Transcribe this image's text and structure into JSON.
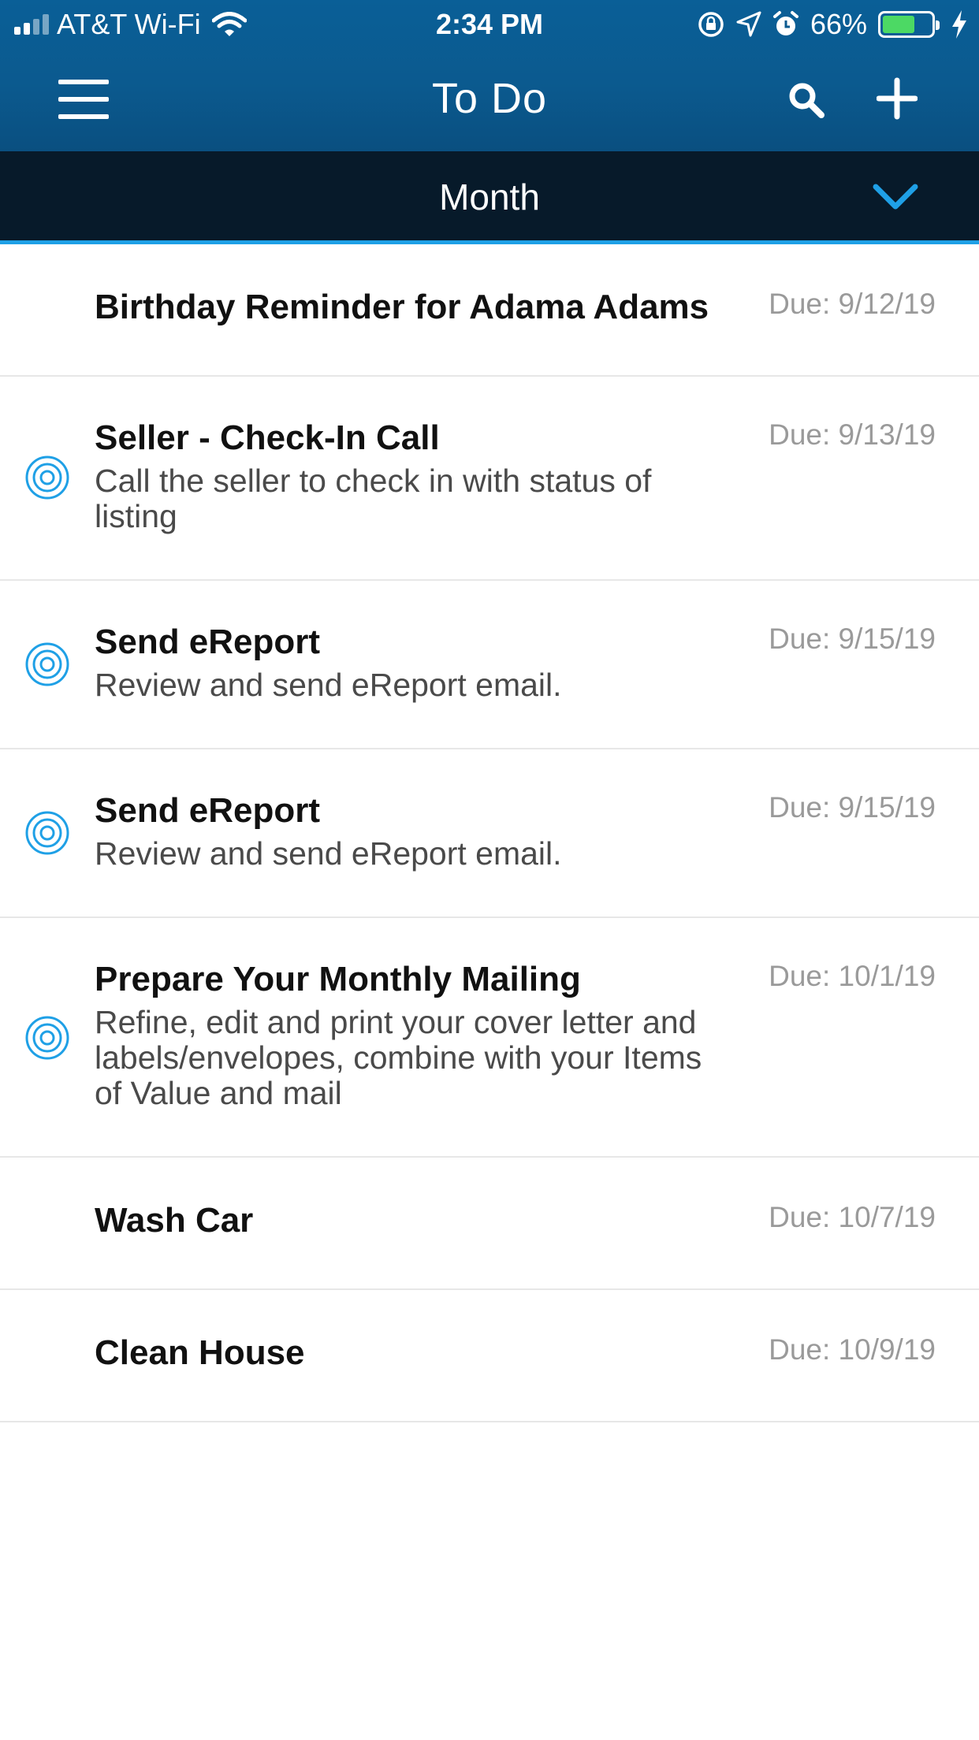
{
  "status_bar": {
    "carrier": "AT&T Wi-Fi",
    "time": "2:34 PM",
    "battery_percent": "66%",
    "battery_level": 0.66,
    "icons": [
      "cellular-signal-icon",
      "wifi-icon",
      "orientation-lock-icon",
      "location-arrow-icon",
      "alarm-icon",
      "battery-icon",
      "charging-bolt-icon"
    ]
  },
  "nav": {
    "title": "To Do",
    "left_icon": "hamburger-menu-icon",
    "right_icons": [
      "search-icon",
      "plus-icon"
    ]
  },
  "filter": {
    "label": "Month",
    "icon": "chevron-down-icon"
  },
  "colors": {
    "nav_background": "#0b5a8f",
    "filter_background": "#071a2a",
    "accent": "#1fa0e6",
    "task_title": "#111111",
    "task_desc": "#4a4a4a",
    "due_text": "#9a9a9a"
  },
  "tasks": [
    {
      "title": "Birthday Reminder for Adama Adams",
      "description": "",
      "due": "Due: 9/12/19",
      "has_target_icon": false
    },
    {
      "title": "Seller - Check-In Call",
      "description": "Call the seller to check in with status of listing",
      "due": "Due: 9/13/19",
      "has_target_icon": true
    },
    {
      "title": "Send eReport",
      "description": "Review and send eReport email.",
      "due": "Due: 9/15/19",
      "has_target_icon": true
    },
    {
      "title": "Send eReport",
      "description": "Review and send eReport email.",
      "due": "Due: 9/15/19",
      "has_target_icon": true
    },
    {
      "title": "Prepare Your Monthly Mailing",
      "description": "Refine, edit and print your cover letter and labels/envelopes, combine with your Items of Value and mail",
      "due": "Due: 10/1/19",
      "has_target_icon": true
    },
    {
      "title": "Wash Car",
      "description": "",
      "due": "Due: 10/7/19",
      "has_target_icon": false
    },
    {
      "title": "Clean House",
      "description": "",
      "due": "Due: 10/9/19",
      "has_target_icon": false
    }
  ]
}
